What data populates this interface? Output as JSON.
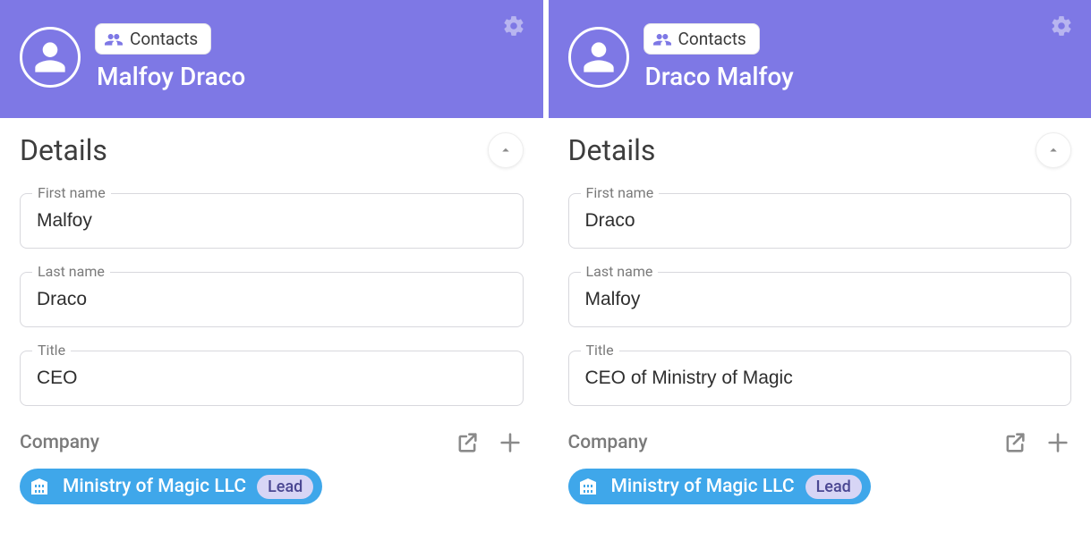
{
  "panels": [
    {
      "chip_label": "Contacts",
      "name": "Malfoy Draco",
      "section_title": "Details",
      "fields": {
        "first_name": {
          "label": "First name",
          "value": "Malfoy"
        },
        "last_name": {
          "label": "Last name",
          "value": "Draco"
        },
        "title": {
          "label": "Title",
          "value": "CEO"
        }
      },
      "company_label": "Company",
      "company": {
        "name": "Ministry of Magic LLC",
        "status": "Lead"
      }
    },
    {
      "chip_label": "Contacts",
      "name": "Draco Malfoy",
      "section_title": "Details",
      "fields": {
        "first_name": {
          "label": "First name",
          "value": "Draco"
        },
        "last_name": {
          "label": "Last name",
          "value": "Malfoy"
        },
        "title": {
          "label": "Title",
          "value": "CEO of Ministry of Magic"
        }
      },
      "company_label": "Company",
      "company": {
        "name": "Ministry of Magic LLC",
        "status": "Lead"
      }
    }
  ]
}
